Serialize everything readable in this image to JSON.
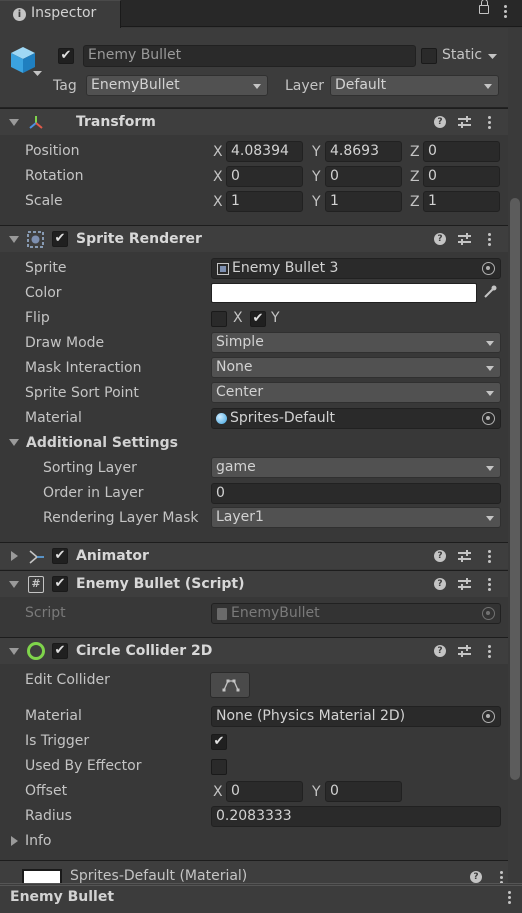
{
  "window": {
    "tab_title": "Inspector"
  },
  "gameobject": {
    "name": "Enemy Bullet",
    "static_label": "Static",
    "tag_label": "Tag",
    "tag_value": "EnemyBullet",
    "layer_label": "Layer",
    "layer_value": "Default"
  },
  "transform": {
    "title": "Transform",
    "rows": [
      {
        "label": "Position",
        "x": "4.08394",
        "y": "4.8693",
        "z": "0"
      },
      {
        "label": "Rotation",
        "x": "0",
        "y": "0",
        "z": "0"
      },
      {
        "label": "Scale",
        "x": "1",
        "y": "1",
        "z": "1"
      }
    ],
    "axis": {
      "x": "X",
      "y": "Y",
      "z": "Z"
    }
  },
  "sprite_renderer": {
    "title": "Sprite Renderer",
    "sprite_label": "Sprite",
    "sprite_value": "Enemy Bullet 3",
    "color_label": "Color",
    "color_value": "#ffffff",
    "flip_label": "Flip",
    "flip_x": "X",
    "flip_y": "Y",
    "draw_mode_label": "Draw Mode",
    "draw_mode_value": "Simple",
    "mask_label": "Mask Interaction",
    "mask_value": "None",
    "sort_point_label": "Sprite Sort Point",
    "sort_point_value": "Center",
    "material_label": "Material",
    "material_value": "Sprites-Default",
    "additional_label": "Additional Settings",
    "sorting_layer_label": "Sorting Layer",
    "sorting_layer_value": "game",
    "order_label": "Order in Layer",
    "order_value": "0",
    "rlm_label": "Rendering Layer Mask",
    "rlm_value": "Layer1"
  },
  "animator": {
    "title": "Animator"
  },
  "script": {
    "title": "Enemy Bullet (Script)",
    "script_label": "Script",
    "script_value": "EnemyBullet"
  },
  "collider": {
    "title": "Circle Collider 2D",
    "edit_label": "Edit Collider",
    "material_label": "Material",
    "material_value": "None (Physics Material 2D)",
    "trigger_label": "Is Trigger",
    "effector_label": "Used By Effector",
    "offset_label": "Offset",
    "offset_x": "0",
    "offset_y": "0",
    "radius_label": "Radius",
    "radius_value": "0.2083333",
    "info_label": "Info"
  },
  "material_asset": {
    "title": "Sprites-Default (Material)"
  },
  "footer": {
    "label": "Enemy Bullet"
  },
  "colors": {
    "bg": "#383838",
    "header": "#3e3e3e",
    "field": "#2a2a2a",
    "accent_green": "#7fd44b"
  }
}
